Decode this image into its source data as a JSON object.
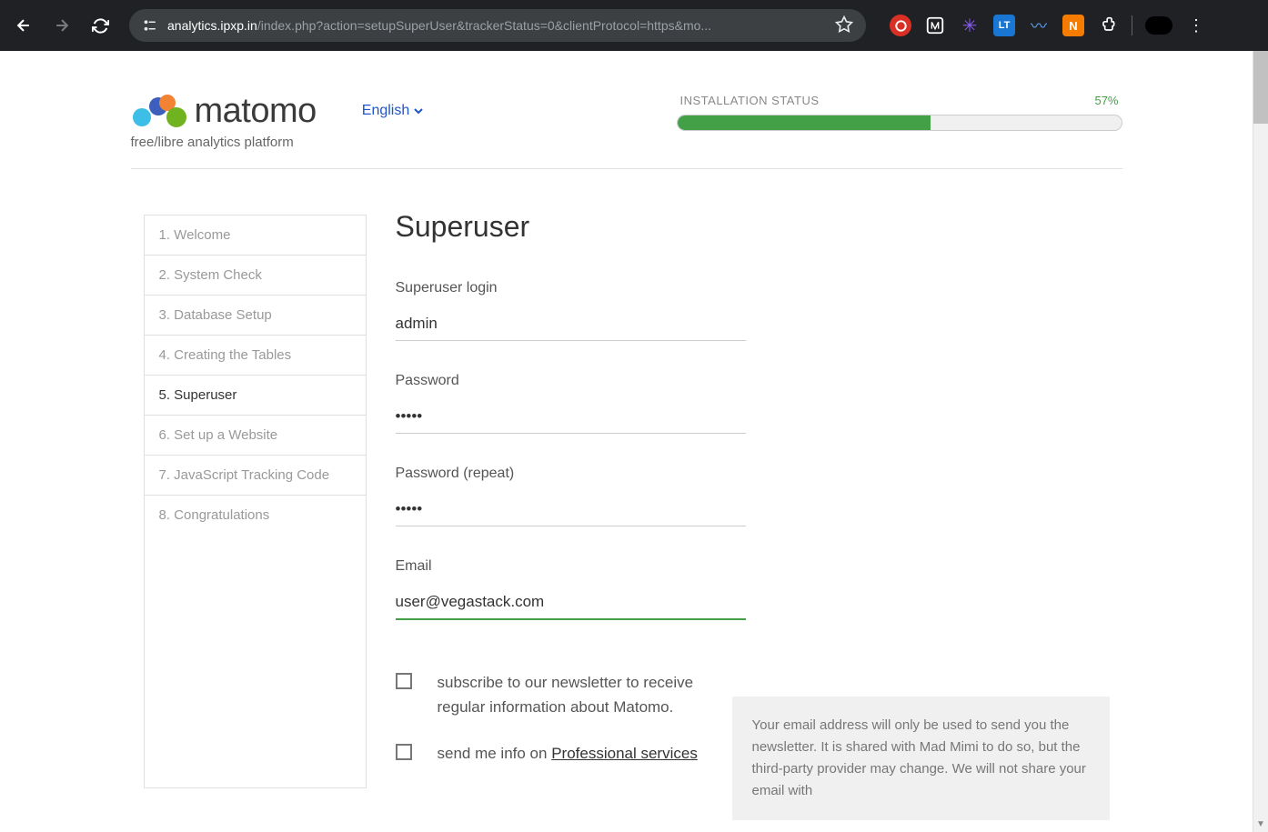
{
  "browser": {
    "url_domain": "analytics.ipxp.in",
    "url_path": "/index.php?action=setupSuperUser&trackerStatus=0&clientProtocol=https&mo..."
  },
  "header": {
    "brand": "matomo",
    "tagline": "free/libre analytics platform",
    "language": "English"
  },
  "status": {
    "label": "INSTALLATION STATUS",
    "percent": "57%",
    "percent_value": 57
  },
  "sidebar": {
    "items": [
      {
        "label": "1. Welcome"
      },
      {
        "label": "2. System Check"
      },
      {
        "label": "3. Database Setup"
      },
      {
        "label": "4. Creating the Tables"
      },
      {
        "label": "5. Superuser"
      },
      {
        "label": "6. Set up a Website"
      },
      {
        "label": "7. JavaScript Tracking Code"
      },
      {
        "label": "8. Congratulations"
      }
    ],
    "active_index": 4
  },
  "main": {
    "title": "Superuser",
    "fields": {
      "login_label": "Superuser login",
      "login_value": "admin",
      "password_label": "Password",
      "password_value": "•••••",
      "password2_label": "Password (repeat)",
      "password2_value": "•••••",
      "email_label": "Email",
      "email_value": "user@vegastack.com"
    },
    "checkboxes": {
      "newsletter": "subscribe to our newsletter to receive regular information about Matomo.",
      "professional_prefix": "send me info on ",
      "professional_link": "Professional services"
    },
    "info_box": "Your email address will only be used to send you the newsletter. It is shared with Mad Mimi to do so, but the third-party provider may change. We will not share your email with"
  }
}
